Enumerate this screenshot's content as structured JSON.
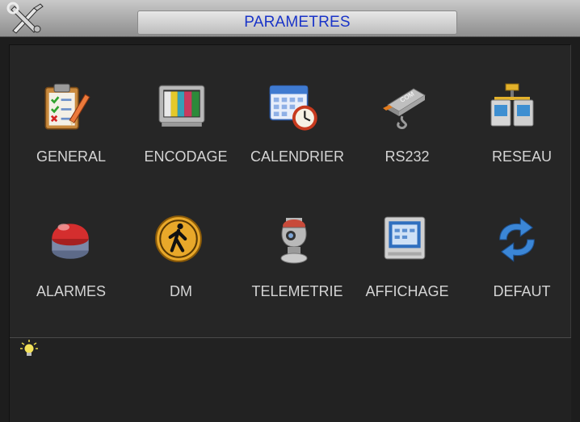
{
  "window": {
    "title": "PARAMETRES"
  },
  "menu": [
    {
      "label": "GENERAL",
      "icon": "clipboard-checklist-icon"
    },
    {
      "label": "ENCODAGE",
      "icon": "monitor-color-bars-icon"
    },
    {
      "label": "CALENDRIER",
      "icon": "calendar-clock-icon"
    },
    {
      "label": "RS232",
      "icon": "com-connector-icon"
    },
    {
      "label": "RESEAU",
      "icon": "network-computers-icon"
    },
    {
      "label": "ALARMES",
      "icon": "red-alarm-light-icon"
    },
    {
      "label": "DM",
      "icon": "walking-person-icon"
    },
    {
      "label": "TELEMETRIE",
      "icon": "ptz-camera-icon"
    },
    {
      "label": "AFFICHAGE",
      "icon": "display-screen-icon"
    },
    {
      "label": "DEFAUT",
      "icon": "refresh-arrows-icon"
    }
  ],
  "tip": {
    "icon": "lightbulb-icon",
    "text": ""
  },
  "colors": {
    "title_text": "#1a34c8",
    "label_text": "#d4d4d4",
    "background": "#1d1d1d"
  }
}
